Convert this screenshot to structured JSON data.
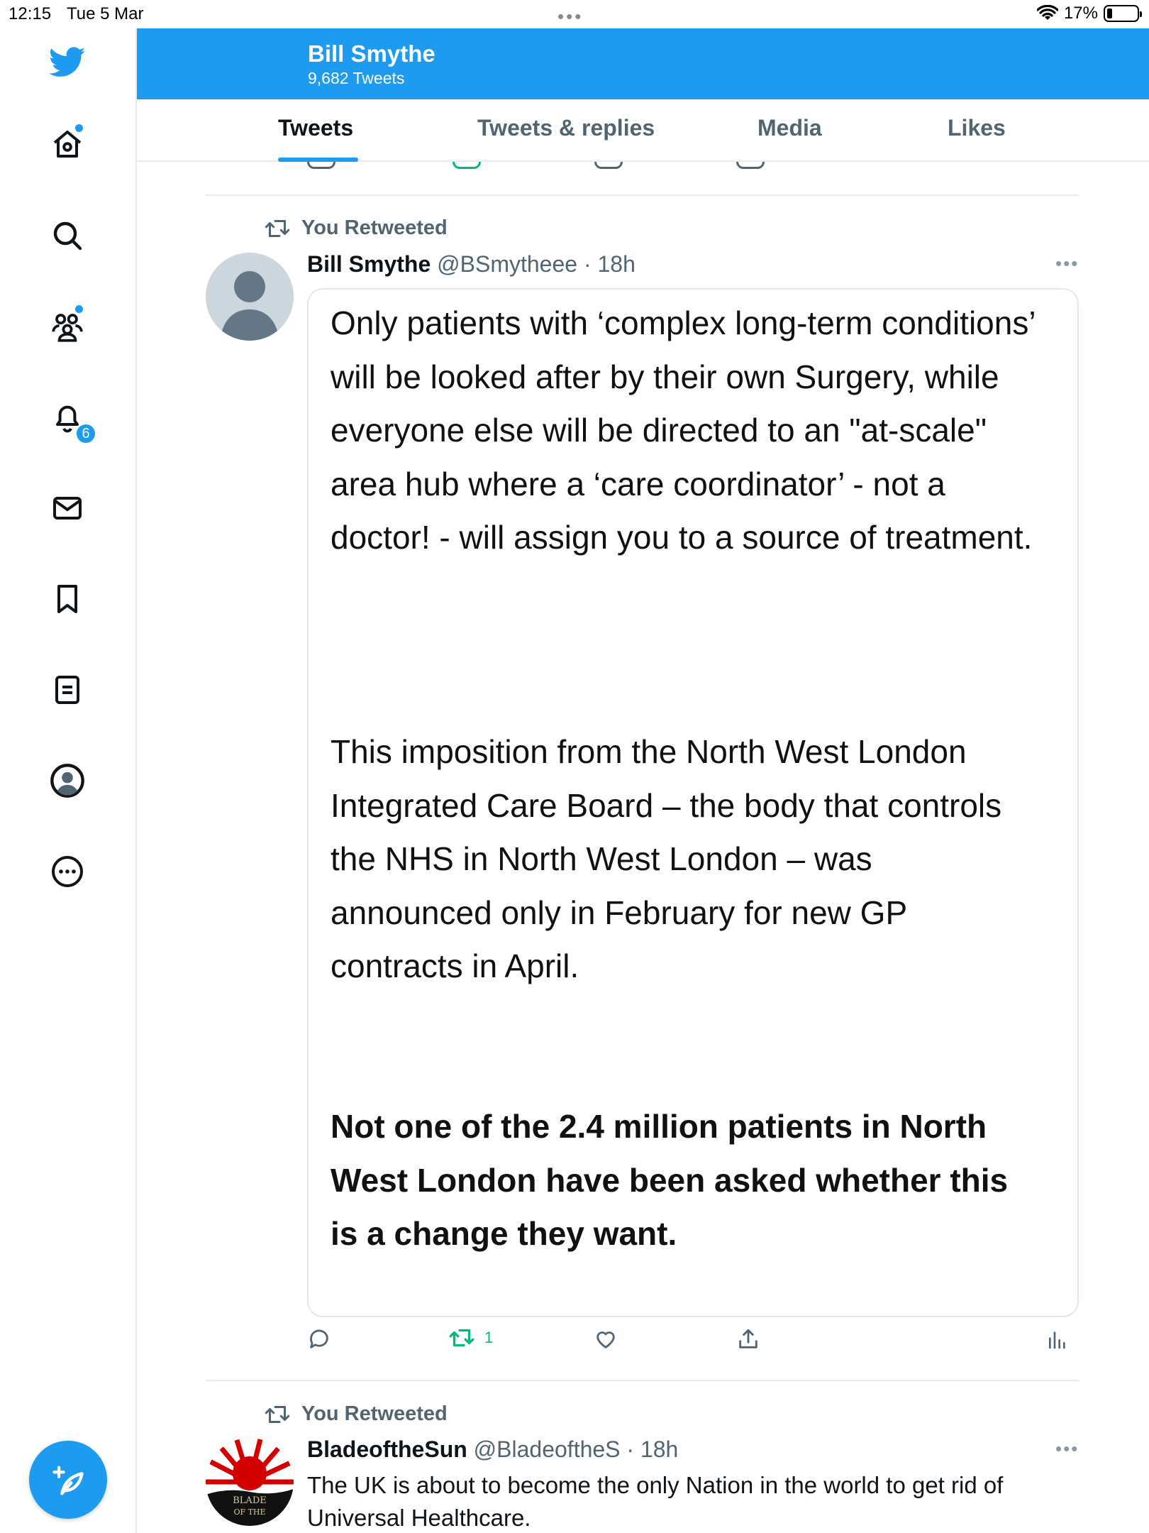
{
  "status_bar": {
    "time": "12:15",
    "date": "Tue 5 Mar",
    "battery": "17%"
  },
  "sidebar": {
    "items": [
      {
        "icon": "home-icon"
      },
      {
        "icon": "search-icon"
      },
      {
        "icon": "communities-icon"
      },
      {
        "icon": "notifications-icon",
        "badge": "6"
      },
      {
        "icon": "messages-icon"
      },
      {
        "icon": "bookmarks-icon"
      },
      {
        "icon": "lists-icon"
      },
      {
        "icon": "profile-icon"
      },
      {
        "icon": "more-icon"
      }
    ],
    "compose_icon": "compose-icon"
  },
  "header": {
    "name": "Bill Smythe",
    "tweet_count": "9,682 Tweets"
  },
  "tabs": [
    {
      "label": "Tweets",
      "active": true
    },
    {
      "label": "Tweets & replies",
      "active": false
    },
    {
      "label": "Media",
      "active": false
    },
    {
      "label": "Likes",
      "active": false
    }
  ],
  "tweets": [
    {
      "retweet_label": "You Retweeted",
      "display_name": "Bill Smythe",
      "handle": "@BSmytheee",
      "time": "18h",
      "image_text": {
        "paragraph1": "Only patients with ‘complex long-term conditions’ will be looked after by their own Surgery, while everyone else will be directed to an \"at-scale\" area hub where a ‘care coordinator’ - not a doctor! -  will assign you to a source of treatment.",
        "paragraph2": "This imposition from the North West London Integrated Care Board – the body that controls the NHS in North West London – was announced only in February for new GP contracts in April.",
        "paragraph3": "Not one of the 2.4 million patients in North West London have been asked whether this is a change they want."
      },
      "retweet_count": "1"
    },
    {
      "retweet_label": "You Retweeted",
      "display_name": "BladeoftheSun",
      "handle": "@BladeoftheS",
      "time": "18h",
      "text": "The UK is about to become the only Nation in the world to get rid of Universal Healthcare.",
      "avatar_text": "BLADE OF THE"
    }
  ],
  "colors": {
    "accent": "#1d9bf0",
    "retweet_green": "#00ba7c",
    "secondary_text": "#536471"
  }
}
